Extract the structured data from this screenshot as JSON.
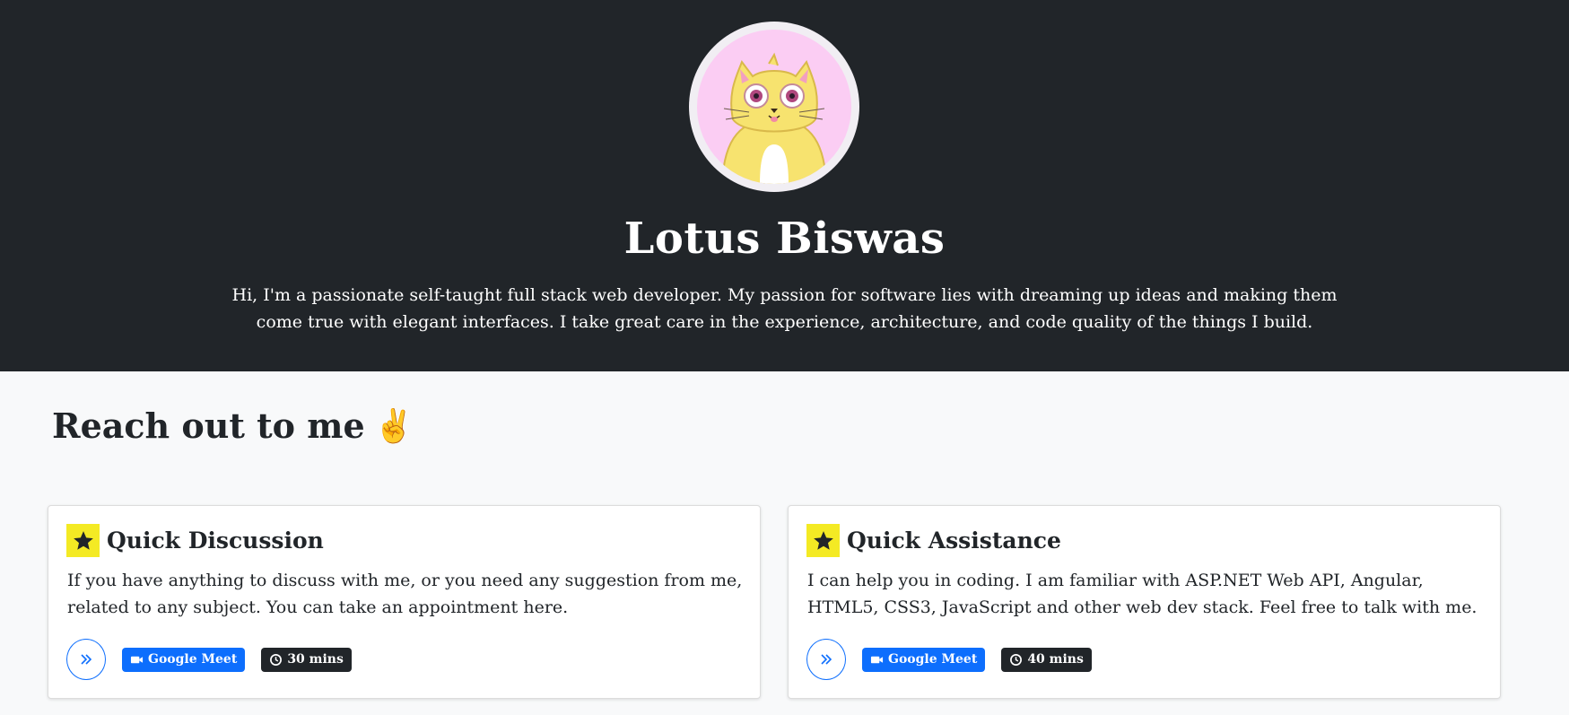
{
  "profile": {
    "name": "Lotus Biswas",
    "bio": "Hi, I'm a passionate self-taught full stack web developer. My passion for software lies with dreaming up ideas and making them come true with elegant interfaces. I take great care in the experience, architecture, and code quality of the things I build.",
    "avatar_icon": "cat-avatar"
  },
  "section": {
    "title": "Reach out to me",
    "emoji": "✌"
  },
  "cards": [
    {
      "title": "Quick Discussion",
      "description": "If you have anything to discuss with me, or you need any suggestion from me, related to any subject. You can take an appointment here.",
      "platform": "Google Meet",
      "duration": "30 mins"
    },
    {
      "title": "Quick Assistance",
      "description": "I can help you in coding. I am familiar with ASP.NET Web API, Angular, HTML5, CSS3, JavaScript and other web dev stack. Feel free to talk with me.",
      "platform": "Google Meet",
      "duration": "40 mins"
    }
  ],
  "colors": {
    "hero_bg": "#212529",
    "page_bg": "#f8f9fa",
    "accent_blue": "#0d6efd",
    "star_bg": "#f4ea24"
  }
}
